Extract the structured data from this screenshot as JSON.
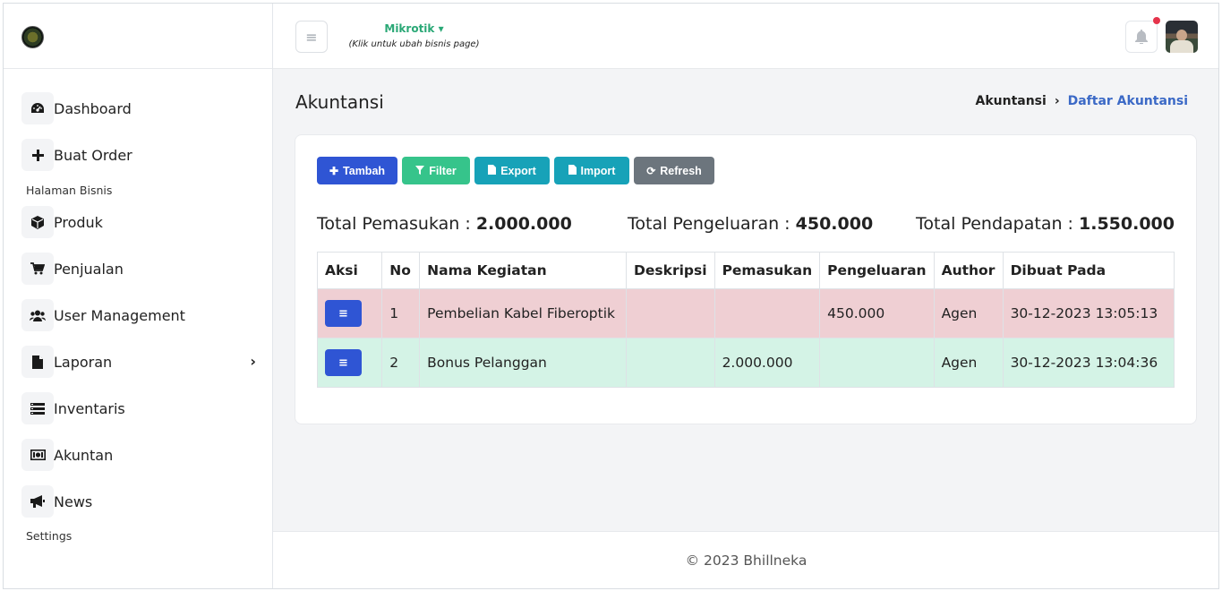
{
  "brand": {
    "logo": "bhillneka-logo"
  },
  "header": {
    "business_name": "Mikrotik",
    "business_hint": "(Klik untuk ubah bisnis page)",
    "menu_icon": "hamburger-icon",
    "notification_icon": "bell-icon"
  },
  "sidebar": {
    "items": [
      {
        "label": "Dashboard",
        "icon": "dashboard-icon"
      },
      {
        "label": "Buat Order",
        "icon": "plus-icon"
      },
      {
        "label": "Produk",
        "icon": "box-icon"
      },
      {
        "label": "Penjualan",
        "icon": "cart-icon"
      },
      {
        "label": "User Management",
        "icon": "users-icon"
      },
      {
        "label": "Laporan",
        "icon": "file-icon"
      },
      {
        "label": "Inventaris",
        "icon": "list-icon"
      },
      {
        "label": "Akuntan",
        "icon": "money-icon"
      },
      {
        "label": "News",
        "icon": "megaphone-icon"
      }
    ],
    "section_business": "Halaman Bisnis",
    "section_settings": "Settings"
  },
  "page": {
    "title": "Akuntansi",
    "breadcrumb": [
      "Akuntansi",
      "Daftar Akuntansi"
    ]
  },
  "toolbar": {
    "tambah": "Tambah",
    "filter": "Filter",
    "export": "Export",
    "import": "Import",
    "refresh": "Refresh"
  },
  "totals": {
    "pemasukan_label": "Total Pemasukan :",
    "pemasukan_value": "2.000.000",
    "pengeluaran_label": "Total Pengeluaran :",
    "pengeluaran_value": "450.000",
    "pendapatan_label": "Total Pendapatan :",
    "pendapatan_value": "1.550.000"
  },
  "table": {
    "headers": [
      "Aksi",
      "No",
      "Nama Kegiatan",
      "Deskripsi",
      "Pemasukan",
      "Pengeluaran",
      "Author",
      "Dibuat Pada"
    ],
    "rows": [
      {
        "no": "1",
        "nama": "Pembelian Kabel Fiberoptik",
        "deskripsi": "",
        "pemasukan": "",
        "pengeluaran": "450.000",
        "author": "Agen",
        "dibuat": "30-12-2023 13:05:13",
        "status_color": "#efcfd3"
      },
      {
        "no": "2",
        "nama": "Bonus Pelanggan",
        "deskripsi": "",
        "pemasukan": "2.000.000",
        "pengeluaran": "",
        "author": "Agen",
        "dibuat": "30-12-2023 13:04:36",
        "status_color": "#d4f3e6"
      }
    ]
  },
  "footer": {
    "text": "© 2023 Bhillneka"
  },
  "colors": {
    "primary": "#2f55d4",
    "success": "#36c48b",
    "info": "#17a2b8",
    "secondary": "#6c757d",
    "link": "#3b69c6"
  }
}
